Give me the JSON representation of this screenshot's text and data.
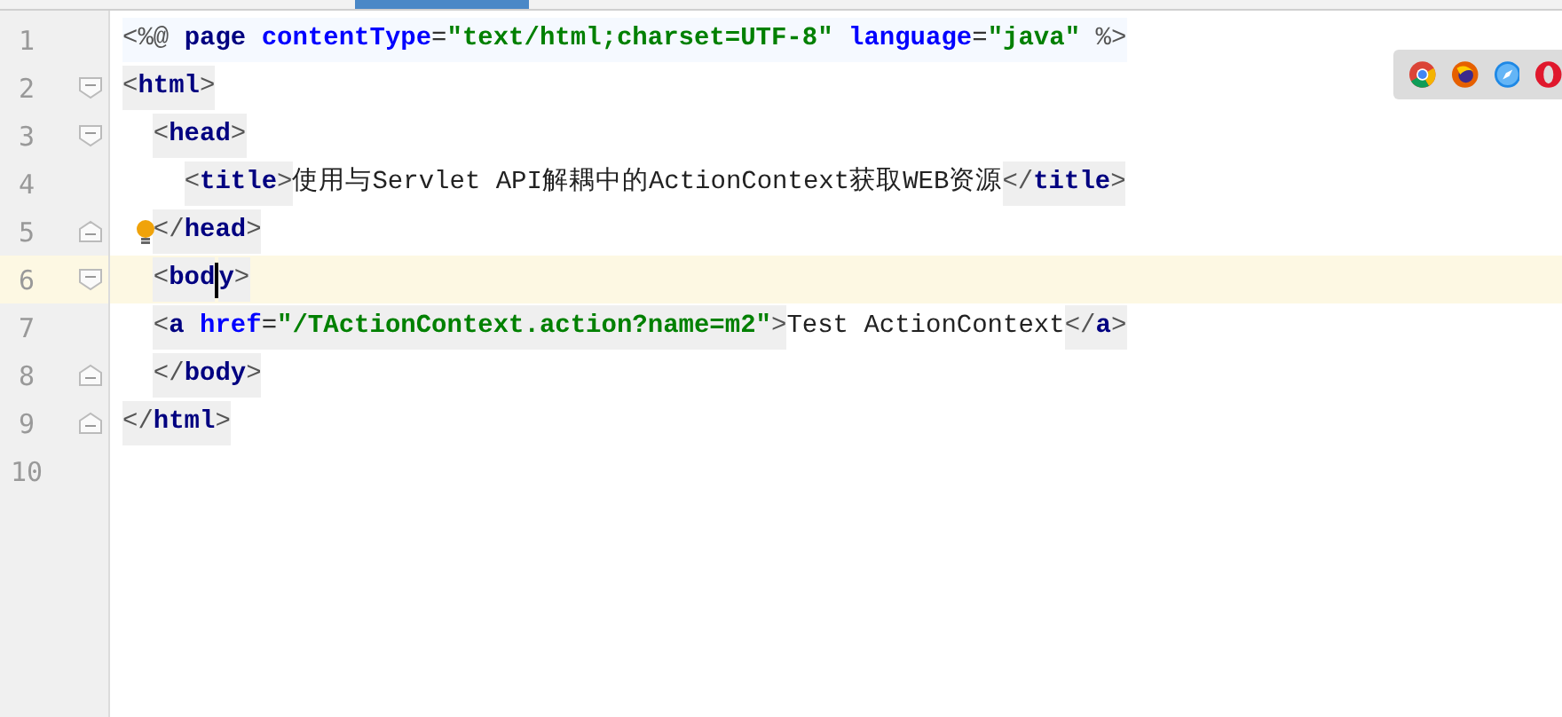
{
  "lines": [
    {
      "number": "1",
      "current": false,
      "bulb": false,
      "fold_open": false,
      "fold_close": false,
      "text": "<%@ page contentType=\"text/html;charset=UTF-8\" language=\"java\" %>"
    },
    {
      "number": "2",
      "current": false,
      "bulb": false,
      "fold_open": true,
      "fold_close": false,
      "text": "<html>"
    },
    {
      "number": "3",
      "current": false,
      "bulb": false,
      "fold_open": true,
      "fold_close": false,
      "text": "  <head>"
    },
    {
      "number": "4",
      "current": false,
      "bulb": false,
      "fold_open": false,
      "fold_close": false,
      "text": "    <title>使用与Servlet API解耦中的ActionContext获取WEB资源</title>"
    },
    {
      "number": "5",
      "current": false,
      "bulb": true,
      "fold_open": false,
      "fold_close": true,
      "text": "  </head>"
    },
    {
      "number": "6",
      "current": true,
      "bulb": false,
      "fold_open": true,
      "fold_close": false,
      "text": "  <bod",
      "text_after_cursor": "y>"
    },
    {
      "number": "7",
      "current": false,
      "bulb": false,
      "fold_open": false,
      "fold_close": false,
      "text": "  <a href=\"/TActionContext.action?name=m2\">Test ActionContext</a>"
    },
    {
      "number": "8",
      "current": false,
      "bulb": false,
      "fold_open": false,
      "fold_close": true,
      "text": "  </body>"
    },
    {
      "number": "9",
      "current": false,
      "bulb": false,
      "fold_open": false,
      "fold_close": true,
      "text": "</html>"
    },
    {
      "number": "10",
      "current": false,
      "bulb": false,
      "fold_open": false,
      "fold_close": false
    }
  ],
  "browser_icons": [
    {
      "kind": "chrome"
    },
    {
      "kind": "firefox"
    },
    {
      "kind": "safari"
    },
    {
      "kind": "opera"
    }
  ]
}
